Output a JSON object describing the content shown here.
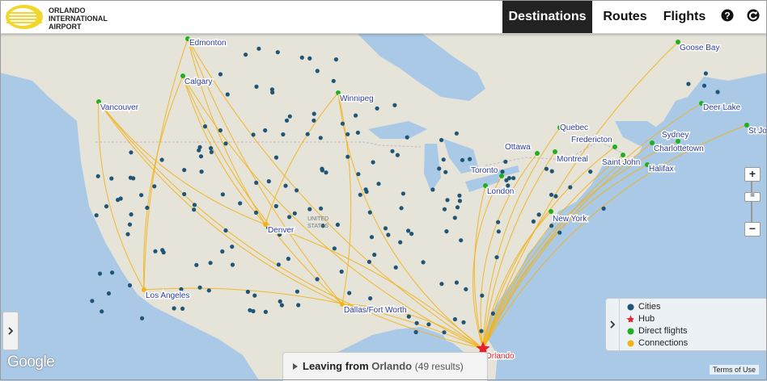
{
  "header": {
    "logo_lines": [
      "ORLANDO",
      "INTERNATIONAL",
      "AIRPORT"
    ],
    "nav": [
      {
        "label": "Destinations",
        "active": true
      },
      {
        "label": "Routes",
        "active": false
      },
      {
        "label": "Flights",
        "active": false
      }
    ],
    "help_icon": "question-icon",
    "refresh_icon": "refresh-icon"
  },
  "map": {
    "country_label": [
      "UNITED",
      "STATES"
    ],
    "hub_label": "Orlando",
    "direct_cities": [
      "Edmonton",
      "Calgary",
      "Vancouver",
      "Winnipeg",
      "Goose Bay",
      "Deer Lake",
      "St Jo",
      "Sydney",
      "Charlottetown",
      "Quebec",
      "Fredericton",
      "Ottawa",
      "Montreal",
      "Saint John",
      "Halifax",
      "Toronto",
      "London",
      "New York"
    ],
    "connection_cities": [
      "Denver",
      "Los Angeles",
      "Dallas/Fort Worth"
    ],
    "colors": {
      "water": "#a9c9e7",
      "land": "#e9e5dc",
      "route": "#f2b318",
      "city": "#1f5577",
      "direct": "#1fb01f",
      "hub": "#e8212c"
    }
  },
  "legend": {
    "items": [
      {
        "label": "Cities",
        "color": "#1f5577"
      },
      {
        "label": "Hub",
        "color": "#e8212c"
      },
      {
        "label": "Direct flights",
        "color": "#1fb01f"
      },
      {
        "label": "Connections",
        "color": "#f2b318"
      }
    ]
  },
  "bottom_panel": {
    "prefix": "Leaving from",
    "city": "Orlando",
    "count": "(49 results)"
  },
  "footer": {
    "google": "Google",
    "terms": "Terms of Use"
  },
  "zoom": {
    "plus": "+",
    "minus": "−"
  }
}
